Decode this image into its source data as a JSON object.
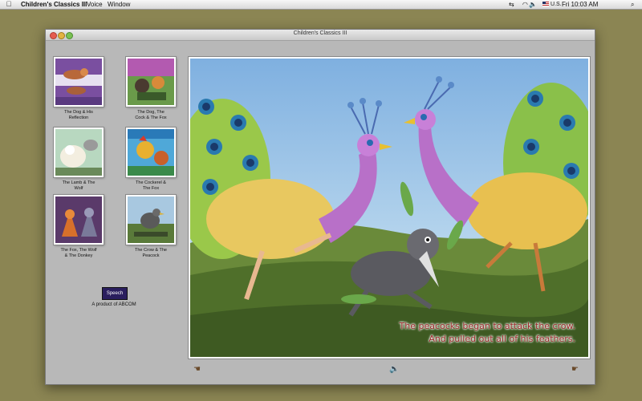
{
  "menubar": {
    "app_name": "Children's Classics III",
    "menus": [
      "Voice",
      "Window"
    ],
    "status_icons": "⇆ ◠",
    "flag_icon": "us-flag-icon",
    "locale": "U.S.",
    "volume_icon": "🔈",
    "clock": "Fri 10:03 AM",
    "search_icon": "⌕"
  },
  "window": {
    "title": "Children's Classics III"
  },
  "stories": [
    {
      "label": "The Dog & His\nReflection"
    },
    {
      "label": "The  Dog, The\nCock & The Fox"
    },
    {
      "label": "The Lamb & The\nWolf"
    },
    {
      "label": "The Cockerel &\nThe Fox"
    },
    {
      "label": "The Fox, The Wolf\n& The Donkey"
    },
    {
      "label": "The Crow & The\nPeacock"
    }
  ],
  "sidebar": {
    "logo_text": "Speech",
    "product_text": "A product of ABCOM"
  },
  "illustration": {
    "line1": "The peacocks began to attack the crow.",
    "line2": "And pulled out all of his feathers."
  },
  "controls": {
    "prev_icon": "☚",
    "sound_icon": "🔈",
    "next_icon": "☛"
  },
  "colors": {
    "desktop": "#8b8553",
    "text_red": "#9a2a2a"
  }
}
